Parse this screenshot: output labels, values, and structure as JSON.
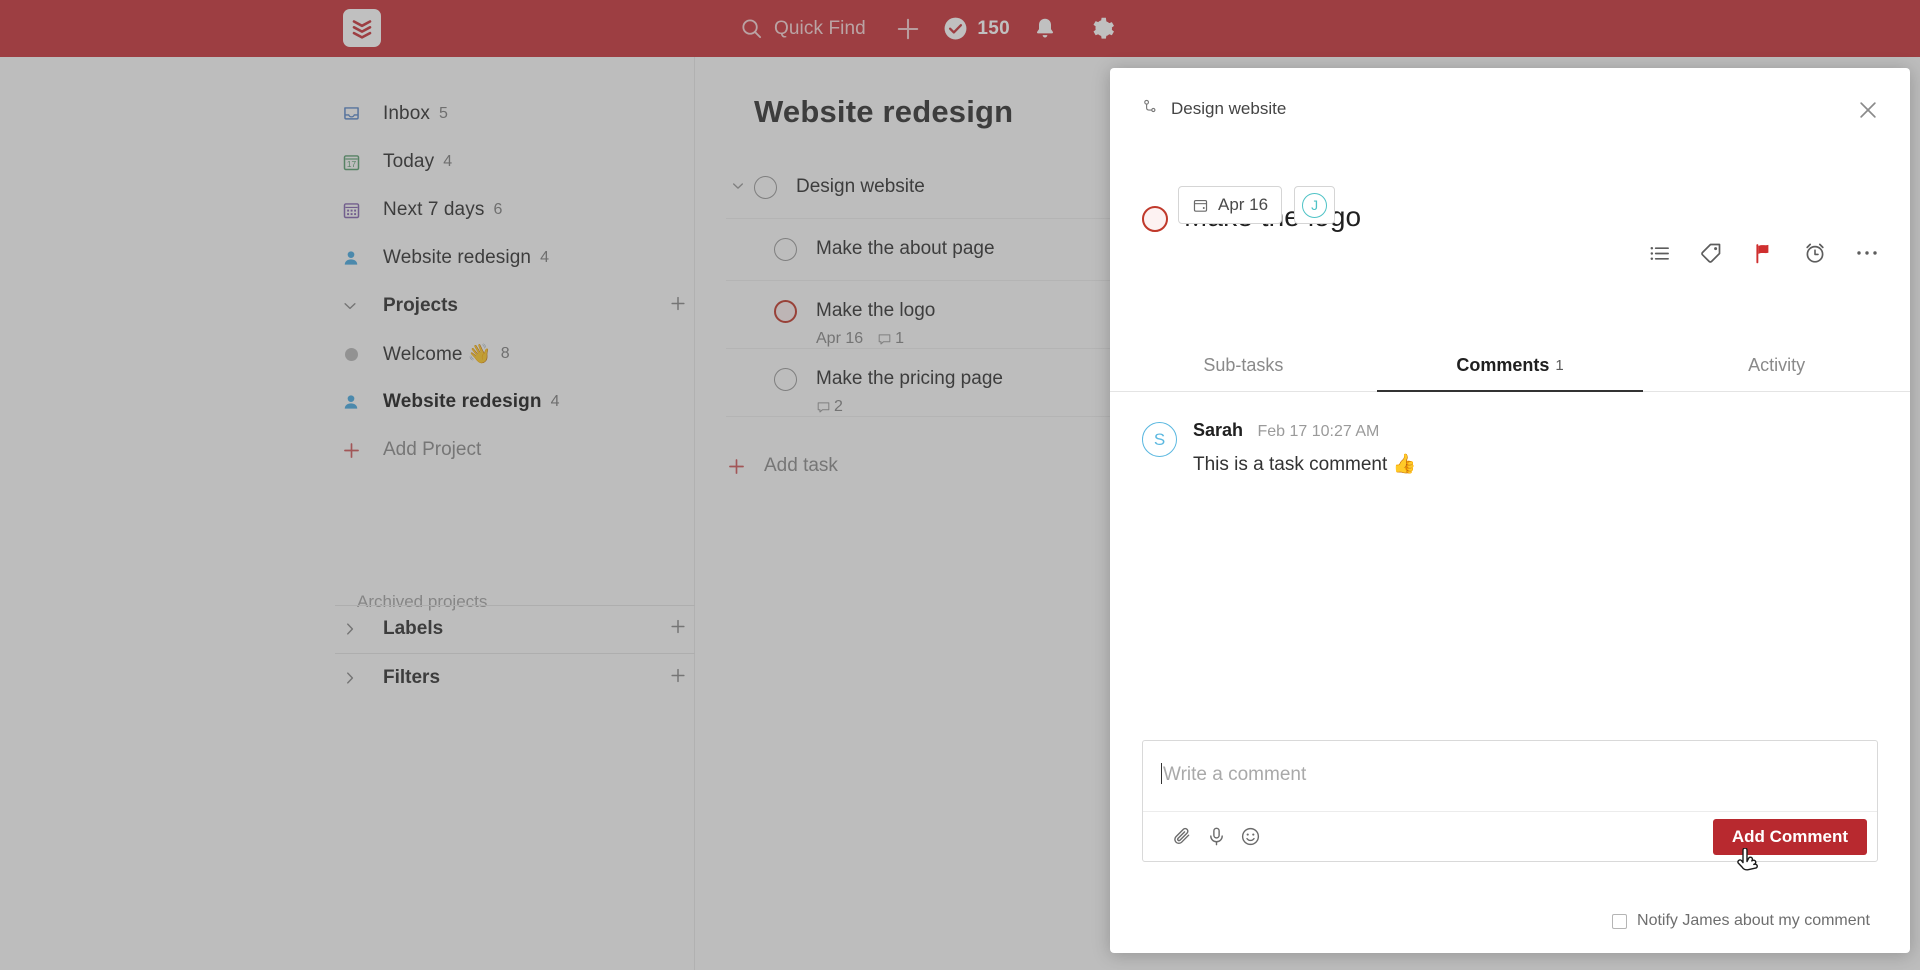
{
  "topbar": {
    "logo_name": "todoist-logo",
    "quick_find_label": "Quick Find",
    "add_label": "+",
    "karma_count": "150",
    "notifications_label": "Notifications",
    "settings_label": "Settings",
    "background_color": "#c9343a"
  },
  "sidebar": {
    "nav": [
      {
        "icon": "inbox-icon",
        "label": "Inbox",
        "count": "5"
      },
      {
        "icon": "today-calendar-icon",
        "label": "Today",
        "count": "4"
      },
      {
        "icon": "next-7-days-icon",
        "label": "Next 7 days",
        "count": "6"
      },
      {
        "icon": "person-icon",
        "label": "Website redesign",
        "count": "4"
      }
    ],
    "projects_section": {
      "title": "Projects",
      "add_label": "+",
      "items": [
        {
          "icon": "project-dot-icon",
          "label": "Welcome 👋",
          "count": "8",
          "bold": false
        },
        {
          "icon": "person-icon",
          "label": "Website redesign",
          "count": "4",
          "bold": true
        }
      ],
      "add_project_label": "Add Project",
      "archived_label": "Archived projects"
    },
    "labels_section": {
      "title": "Labels",
      "add_label": "+"
    },
    "filters_section": {
      "title": "Filters",
      "add_label": "+"
    }
  },
  "main": {
    "title": "Website redesign",
    "tasks": [
      {
        "name": "Design website",
        "level": "parent",
        "priority": false,
        "date": "",
        "comments": ""
      },
      {
        "name": "Make the about page",
        "level": "sub",
        "priority": false,
        "date": "",
        "comments": ""
      },
      {
        "name": "Make the logo",
        "level": "sub",
        "priority": true,
        "date": "Apr 16",
        "comments": "1"
      },
      {
        "name": "Make the pricing page",
        "level": "sub",
        "priority": false,
        "date": "",
        "comments": "2"
      }
    ],
    "add_task_label": "Add task"
  },
  "panel": {
    "breadcrumb": "Design website",
    "breadcrumb_icon": "sub-task-branch-icon",
    "close_label": "Close",
    "task_title": "Make the logo",
    "date_pill": {
      "icon": "calendar-icon",
      "label": "Apr 16"
    },
    "assignee_pill": {
      "initial": "J",
      "color": "#4fc3c6"
    },
    "actions": [
      {
        "icon": "sub-task-list-icon",
        "label": "Sub-tasks"
      },
      {
        "icon": "tag-icon",
        "label": "Labels"
      },
      {
        "icon": "flag-icon",
        "label": "Priority"
      },
      {
        "icon": "alarm-clock-icon",
        "label": "Reminders"
      },
      {
        "icon": "more-ellipsis-icon",
        "label": "More"
      }
    ],
    "tabs": [
      {
        "label": "Sub-tasks",
        "count": "",
        "active": false
      },
      {
        "label": "Comments",
        "count": "1",
        "active": true
      },
      {
        "label": "Activity",
        "count": "",
        "active": false
      }
    ],
    "comments": [
      {
        "avatar_initial": "S",
        "author": "Sarah",
        "time": "Feb 17 10:27 AM",
        "text": "This is a task comment 👍"
      }
    ],
    "composer": {
      "placeholder": "Write a comment",
      "attach_icon": "paperclip-icon",
      "voice_icon": "microphone-icon",
      "emoji_icon": "emoji-icon",
      "submit_label": "Add Comment"
    },
    "notify": {
      "label": "Notify James about my comment",
      "checked": false
    }
  },
  "colors": {
    "brand_red": "#c9343a",
    "button_red": "#b8292f",
    "priority_red": "#c0392b",
    "accent_blue": "#5bb8e0",
    "accent_teal": "#4fc3c6"
  }
}
